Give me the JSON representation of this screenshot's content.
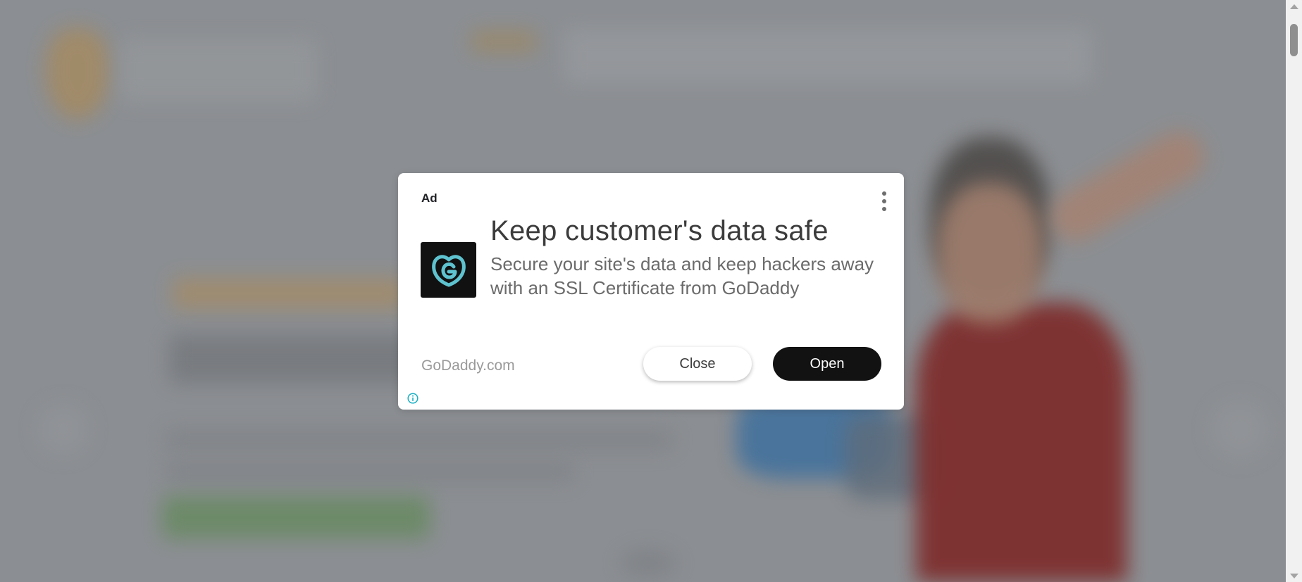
{
  "ad": {
    "label": "Ad",
    "headline": "Keep customer's data safe",
    "body": "Secure your site's data and keep hackers away with an SSL Certificate from GoDaddy",
    "advertiser": "GoDaddy.com",
    "close_label": "Close",
    "open_label": "Open",
    "logo_icon": "godaddy-logo-icon",
    "menu_icon": "more-vert-icon",
    "info_icon": "info-icon"
  },
  "colors": {
    "logo_bg": "#111111",
    "logo_mark": "#5ec2cf",
    "open_button": "#121212",
    "info_icon": "#1ab0c4",
    "overlay": "#8b8e92"
  }
}
